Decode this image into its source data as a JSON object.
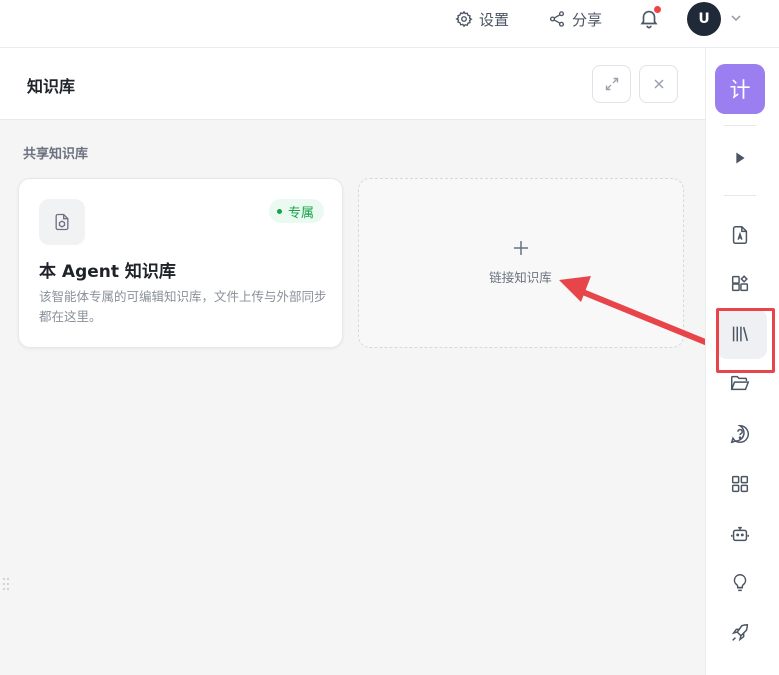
{
  "topbar": {
    "settings_label": "设置",
    "share_label": "分享",
    "avatar_letter": "U"
  },
  "panel": {
    "title": "知识库",
    "section_label": "共享知识库"
  },
  "card": {
    "badge": "专属",
    "title": "本 Agent 知识库",
    "description": "该智能体专属的可编辑知识库，文件上传与外部同步都在这里。"
  },
  "link_card": {
    "label": "链接知识库"
  },
  "sidebar": {
    "top_button": "计",
    "icons": [
      "play-icon",
      "document-icon",
      "plugin-icon",
      "library-icon",
      "folder-icon",
      "help-icon",
      "grid-icon",
      "bot-icon",
      "lightbulb-icon",
      "rocket-icon"
    ],
    "active": "library-icon"
  },
  "colors": {
    "accent": "#9b7ff0",
    "badge_green": "#16a34a",
    "highlight_red": "#e8454b",
    "notification_red": "#ef4444"
  }
}
